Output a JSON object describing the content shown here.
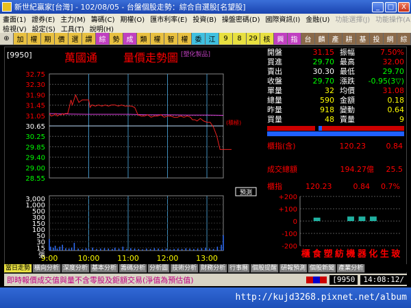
{
  "window": {
    "title": "新世紀贏家[台灣] - 102/08/05 - 台盤個股走勢：綜合自選股[名望股]",
    "btn_min": "_",
    "btn_max": "□",
    "btn_close": "X"
  },
  "menu": {
    "row1": [
      "畫面(1)",
      "證券(E)",
      "主力(M)",
      "籌碼(C)",
      "期權(O)",
      "匯市利率(E)",
      "投資(B)",
      "操盤密碼(D)",
      "國際資訊(I)",
      "金融(U)",
      "功能選擇(J)",
      "功能操作(A)"
    ],
    "row2": [
      "檢視(V)",
      "設定(S)",
      "工具(T)",
      "說明(H)"
    ]
  },
  "toolbar": [
    {
      "label": "⊕",
      "bg": "#d8d4c4",
      "fg": "#000"
    },
    {
      "label": "加",
      "bg": "#e8c040",
      "fg": "#000"
    },
    {
      "label": "權",
      "bg": "#e8c040",
      "fg": "#000"
    },
    {
      "label": "期",
      "bg": "#e8c040",
      "fg": "#000"
    },
    {
      "label": "價",
      "bg": "#e8c040",
      "fg": "#000"
    },
    {
      "label": "選",
      "bg": "#e8c040",
      "fg": "#000"
    },
    {
      "label": "謂",
      "bg": "#e8c040",
      "fg": "#000"
    },
    {
      "label": "綜",
      "bg": "#c040c0",
      "fg": "#fff"
    },
    {
      "label": "勢",
      "bg": "#e8c040",
      "fg": "#000"
    },
    {
      "label": "成",
      "bg": "#c040c0",
      "fg": "#fff"
    },
    {
      "label": "類",
      "bg": "#e8c040",
      "fg": "#000"
    },
    {
      "label": "權",
      "bg": "#e8c040",
      "fg": "#000"
    },
    {
      "label": "智",
      "bg": "#e8c040",
      "fg": "#000"
    },
    {
      "label": "權",
      "bg": "#e8c040",
      "fg": "#000"
    },
    {
      "label": "委",
      "bg": "#40c0e0",
      "fg": "#000"
    },
    {
      "label": "江",
      "bg": "#40c0e0",
      "fg": "#000"
    },
    {
      "label": "9",
      "bg": "#e8e040",
      "fg": "#000"
    },
    {
      "label": "8",
      "bg": "#e8e040",
      "fg": "#000"
    },
    {
      "label": "29",
      "bg": "#e8e040",
      "fg": "#000"
    },
    {
      "label": "核",
      "bg": "#e8e040",
      "fg": "#000"
    },
    {
      "label": "興",
      "bg": "#c040c0",
      "fg": "#fff"
    },
    {
      "label": "指",
      "bg": "#c040c0",
      "fg": "#fff"
    },
    {
      "label": "台",
      "bg": "#8a6a4a",
      "fg": "#fff"
    },
    {
      "label": "麟",
      "bg": "#8a6a4a",
      "fg": "#fff"
    },
    {
      "label": "產",
      "bg": "#8a6a4a",
      "fg": "#fff"
    },
    {
      "label": "耕",
      "bg": "#8a6a4a",
      "fg": "#fff"
    },
    {
      "label": "基",
      "bg": "#8a6a4a",
      "fg": "#fff"
    },
    {
      "label": "投",
      "bg": "#8a6a4a",
      "fg": "#fff"
    },
    {
      "label": "網",
      "bg": "#8a6a4a",
      "fg": "#fff"
    },
    {
      "label": "綜",
      "bg": "#8a6a4a",
      "fg": "#fff"
    }
  ],
  "stock": {
    "code": "[9950]",
    "name": "萬國通",
    "chart_title": "量價走勢圖",
    "category": "[塑化製品]",
    "high_marker": "(積極)",
    "predict_btn": "預測"
  },
  "quote": {
    "rows": [
      {
        "l1": "開盤",
        "v1": "31.15",
        "l2": "振幅",
        "v2": "7.50%",
        "c1": "#f00",
        "c2": "#f00"
      },
      {
        "l1": "買進",
        "v1": "29.70",
        "l2": "最高",
        "v2": "32.00",
        "c1": "#0f0",
        "c2": "#f00"
      },
      {
        "l1": "賣出",
        "v1": "30.30",
        "l2": "最低",
        "v2": "29.70",
        "c1": "#fff",
        "c2": "#0f0"
      },
      {
        "l1": "收盤",
        "v1": "29.70",
        "l2": "漲跌",
        "v2": "-0.95(3▽)",
        "c1": "#0f0",
        "c2": "#0f0"
      },
      {
        "l1": "單量",
        "v1": "32",
        "l2": "均價",
        "v2": "31.08",
        "c1": "#ff0",
        "c2": "#f00"
      },
      {
        "l1": "總量",
        "v1": "590",
        "l2": "金額",
        "v2": "0.18",
        "c1": "#ff0",
        "c2": "#ff0"
      },
      {
        "l1": "昨量",
        "v1": "918",
        "l2": "變動",
        "v2": "0.64",
        "c1": "#ff0",
        "c2": "#ff0"
      },
      {
        "l1": "買量",
        "v1": "48",
        "l2": "賣量",
        "v2": "9",
        "c1": "#ff0",
        "c2": "#ff0"
      }
    ],
    "index_label": "櫃指(含)",
    "index_value": "120.23",
    "index_change": "0.84",
    "turnover_label": "成交總額",
    "turnover_value": "194.27億",
    "turnover_change": "25.5",
    "mini_label": "櫃指",
    "mini_value": "120.23",
    "mini_change": "0.84",
    "mini_pct": "0.7%"
  },
  "sector_chart": {
    "yticks": [
      "+200",
      "+100",
      "0",
      "-100",
      "-200"
    ],
    "ylim": [
      -200,
      200
    ],
    "values": [
      0,
      28,
      0,
      0,
      37,
      37,
      37,
      0,
      0
    ],
    "labels": [
      "櫃",
      "食",
      "塑",
      "紡",
      "機",
      "器",
      "化",
      "生",
      "玻"
    ]
  },
  "chart_data": {
    "type": "line",
    "xlabels": [
      "9:00",
      "10:00",
      "11:00",
      "12:00",
      "13:00"
    ],
    "yticks": [
      "32.75",
      "32.30",
      "31.90",
      "31.45",
      "31.05",
      "30.65",
      "30.25",
      "29.85",
      "29.40",
      "29.00",
      "28.55"
    ],
    "ylim": [
      28.55,
      32.75
    ],
    "ref_price": 30.65,
    "price_x": [
      0,
      3,
      8,
      10,
      12,
      15,
      18,
      20,
      22,
      24,
      27,
      28,
      30,
      33,
      35,
      40,
      45,
      50,
      55,
      60,
      62,
      65,
      70,
      75,
      80,
      85,
      90,
      95,
      100,
      105,
      110,
      115,
      120,
      125,
      130,
      135,
      140,
      145,
      150,
      155,
      160,
      165,
      170,
      175,
      180,
      185,
      190,
      195,
      200,
      205,
      210,
      215,
      218,
      222,
      225,
      230,
      235,
      240,
      245,
      250,
      255,
      260,
      265
    ],
    "price_y": [
      31.15,
      31.05,
      31.1,
      31.15,
      31.05,
      31.1,
      31.1,
      31.15,
      31.1,
      31.15,
      31.15,
      31.15,
      31.35,
      31.7,
      31.5,
      31.9,
      31.6,
      31.7,
      31.7,
      31.7,
      31.4,
      31.5,
      31.45,
      31.5,
      31.45,
      31.5,
      31.45,
      31.5,
      31.5,
      31.45,
      31.5,
      31.45,
      31.45,
      31.45,
      31.4,
      31.1,
      31.05,
      31.05,
      31.1,
      31.0,
      31.05,
      31.05,
      31.1,
      31.0,
      31.05,
      31.05,
      31.0,
      31.0,
      31.05,
      31.0,
      31.05,
      31.0,
      30.9,
      30.9,
      30.85,
      30.95,
      30.85,
      30.8,
      30.8,
      30.6,
      30.25,
      29.7,
      29.7
    ],
    "avg_x": [
      0,
      30,
      60,
      90,
      120,
      150,
      180,
      210,
      240,
      265
    ],
    "avg_y": [
      31.15,
      31.13,
      31.12,
      31.12,
      31.12,
      31.1,
      31.1,
      31.09,
      31.09,
      31.08
    ],
    "vol_yticks": [
      "3,000",
      "1,000",
      "500",
      "300",
      "150",
      "100",
      "50",
      "30",
      "15"
    ],
    "vol_unit": "張",
    "vol_x": [
      0,
      2,
      6,
      9,
      12,
      16,
      20,
      25,
      30,
      34,
      38,
      44,
      50,
      56,
      60,
      66,
      72,
      78,
      84,
      90,
      96,
      100,
      106,
      112,
      118,
      124,
      130,
      136,
      142,
      148,
      154,
      160,
      166,
      172,
      178,
      184,
      190,
      196,
      202,
      208,
      214,
      220,
      226,
      232,
      238,
      244,
      250,
      256,
      262,
      265
    ],
    "vol_v": [
      60,
      20,
      15,
      25,
      10,
      20,
      30,
      12,
      10,
      15,
      40,
      10,
      8,
      12,
      10,
      15,
      8,
      10,
      12,
      10,
      8,
      15,
      10,
      20,
      8,
      12,
      10,
      8,
      6,
      10,
      8,
      12,
      10,
      8,
      10,
      6,
      8,
      10,
      8,
      12,
      10,
      8,
      10,
      12,
      15,
      10,
      8,
      20,
      30,
      80
    ]
  },
  "tabs": [
    "當日走勢",
    "橫向分析",
    "深度分析",
    "基本分析",
    "籌碼分析",
    "分析圖",
    "技術分析",
    "財務分析",
    "行事曆",
    "個股提醒",
    "研報預測",
    "個股新聞",
    "產業分析"
  ],
  "status": {
    "message": "即時報價成交值與量不含零股及鉅額交易(淨值為預估值)",
    "code": "[9950",
    "time": "14:08:12/"
  },
  "taskbar": {
    "url": "http://kujd3268.pixnet.net/album"
  }
}
